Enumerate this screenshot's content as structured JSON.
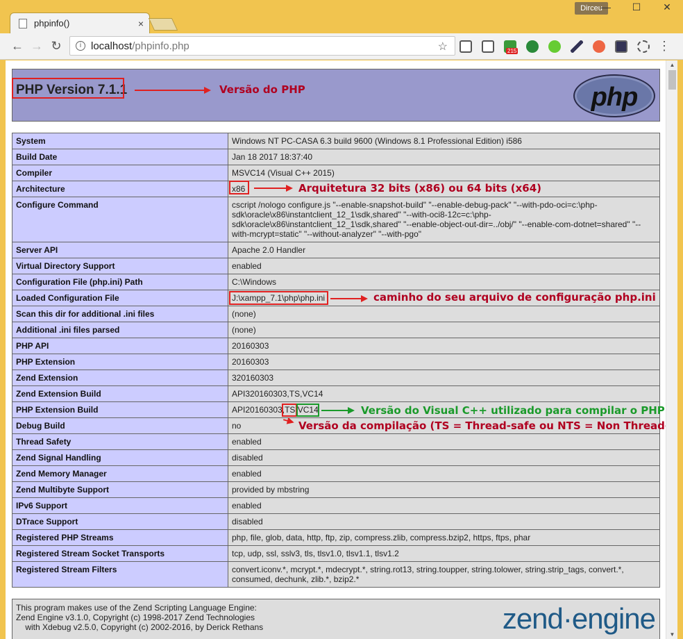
{
  "browser": {
    "tab_title": "phpinfo()",
    "tab_close": "×",
    "profile": "Dirceu",
    "window_min": "—",
    "window_max": "☐",
    "window_close": "✕",
    "back": "←",
    "forward": "→",
    "reload": "↻",
    "url_host": "localhost",
    "url_path": "/phpinfo.php",
    "star": "☆",
    "menu": "⋮",
    "badge": "215"
  },
  "header": {
    "version": "PHP Version 7.1.1",
    "logo_text": "php",
    "annotation": "Versão do PHP"
  },
  "rows": [
    {
      "k": "System",
      "v": "Windows NT PC-CASA 6.3 build 9600 (Windows 8.1 Professional Edition) i586"
    },
    {
      "k": "Build Date",
      "v": "Jan 18 2017 18:37:40"
    },
    {
      "k": "Compiler",
      "v": "MSVC14 (Visual C++ 2015)"
    },
    {
      "k": "Architecture",
      "v": "x86"
    },
    {
      "k": "Configure Command",
      "v": "cscript /nologo configure.js \"--enable-snapshot-build\" \"--enable-debug-pack\" \"--with-pdo-oci=c:\\php-sdk\\oracle\\x86\\instantclient_12_1\\sdk,shared\" \"--with-oci8-12c=c:\\php-sdk\\oracle\\x86\\instantclient_12_1\\sdk,shared\" \"--enable-object-out-dir=../obj/\" \"--enable-com-dotnet=shared\" \"--with-mcrypt=static\" \"--without-analyzer\" \"--with-pgo\""
    },
    {
      "k": "Server API",
      "v": "Apache 2.0 Handler"
    },
    {
      "k": "Virtual Directory Support",
      "v": "enabled"
    },
    {
      "k": "Configuration File (php.ini) Path",
      "v": "C:\\Windows"
    },
    {
      "k": "Loaded Configuration File",
      "v": "J:\\xampp_7.1\\php\\php.ini"
    },
    {
      "k": "Scan this dir for additional .ini files",
      "v": "(none)"
    },
    {
      "k": "Additional .ini files parsed",
      "v": "(none)"
    },
    {
      "k": "PHP API",
      "v": "20160303"
    },
    {
      "k": "PHP Extension",
      "v": "20160303"
    },
    {
      "k": "Zend Extension",
      "v": "320160303"
    },
    {
      "k": "Zend Extension Build",
      "v": "API320160303,TS,VC14"
    },
    {
      "k": "PHP Extension Build",
      "v": "API20160303,TS,VC14"
    },
    {
      "k": "Debug Build",
      "v": "no"
    },
    {
      "k": "Thread Safety",
      "v": "enabled"
    },
    {
      "k": "Zend Signal Handling",
      "v": "disabled"
    },
    {
      "k": "Zend Memory Manager",
      "v": "enabled"
    },
    {
      "k": "Zend Multibyte Support",
      "v": "provided by mbstring"
    },
    {
      "k": "IPv6 Support",
      "v": "enabled"
    },
    {
      "k": "DTrace Support",
      "v": "disabled"
    },
    {
      "k": "Registered PHP Streams",
      "v": "php, file, glob, data, http, ftp, zip, compress.zlib, compress.bzip2, https, ftps, phar"
    },
    {
      "k": "Registered Stream Socket Transports",
      "v": "tcp, udp, ssl, sslv3, tls, tlsv1.0, tlsv1.1, tlsv1.2"
    },
    {
      "k": "Registered Stream Filters",
      "v": "convert.iconv.*, mcrypt.*, mdecrypt.*, string.rot13, string.toupper, string.tolower, string.strip_tags, convert.*, consumed, dechunk, zlib.*, bzip2.*"
    }
  ],
  "annotations": {
    "architecture": "Arquitetura 32 bits (x86) ou 64 bits (x64)",
    "config_file": "caminho do seu arquivo de configuração php.ini",
    "vc_version": "Versão do Visual C++ utilizado para compilar o PHP",
    "ts_version": "Versão da compilação (TS = Thread-safe ou NTS = Non Thread-Safe)"
  },
  "zend": {
    "line1": "This program makes use of the Zend Scripting Language Engine:",
    "line2": "Zend Engine v3.1.0, Copyright (c) 1998-2017 Zend Technologies",
    "line3": "    with Xdebug v2.5.0, Copyright (c) 2002-2016, by Derick Rethans",
    "logo": "zend·engine"
  },
  "colors": {
    "accent_red": "#e02020",
    "accent_green": "#1a9a2a",
    "annotation_text": "#b00020",
    "php_header_bg": "#9999cc",
    "key_bg": "#ccccff",
    "value_bg": "#dddddd"
  }
}
